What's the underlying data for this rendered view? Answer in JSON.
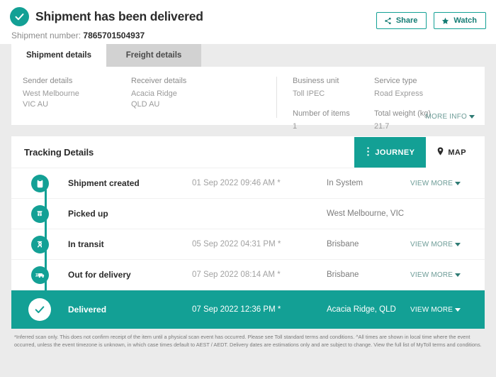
{
  "header": {
    "status_title": "Shipment has been delivered",
    "shipment_number_label": "Shipment number:",
    "shipment_number_value": "7865701504937",
    "share_label": "Share",
    "watch_label": "Watch"
  },
  "tabs": [
    {
      "label": "Shipment details",
      "active": true
    },
    {
      "label": "Freight details",
      "active": false
    }
  ],
  "details": {
    "sender": {
      "label": "Sender details",
      "line1": "West Melbourne",
      "line2": "VIC AU"
    },
    "receiver": {
      "label": "Receiver details",
      "line1": "Acacia Ridge",
      "line2": "QLD AU"
    },
    "business_unit": {
      "label": "Business unit",
      "value": "Toll IPEC"
    },
    "service_type": {
      "label": "Service type",
      "value": "Road Express"
    },
    "number_of_items": {
      "label": "Number of items",
      "value": "1"
    },
    "total_weight": {
      "label": "Total weight (kg)",
      "value": "21.7"
    },
    "more_info_label": "MORE INFO"
  },
  "tracking": {
    "title": "Tracking Details",
    "journey_label": "JOURNEY",
    "map_label": "MAP",
    "view_more_label": "VIEW MORE",
    "events": [
      {
        "icon": "clipboard-icon",
        "label": "Shipment created",
        "date": "01 Sep 2022 09:46 AM *",
        "location": "In System",
        "has_view_more": true,
        "delivered": false
      },
      {
        "icon": "pickup-box-icon",
        "label": "Picked up",
        "date": "",
        "location": "West Melbourne, VIC",
        "has_view_more": false,
        "delivered": false
      },
      {
        "icon": "in-transit-icon",
        "label": "In transit",
        "date": "05 Sep 2022 04:31 PM *",
        "location": "Brisbane",
        "has_view_more": true,
        "delivered": false
      },
      {
        "icon": "delivery-truck-icon",
        "label": "Out for delivery",
        "date": "07 Sep 2022 08:14 AM *",
        "location": "Brisbane",
        "has_view_more": true,
        "delivered": false
      },
      {
        "icon": "check-circle-icon",
        "label": "Delivered",
        "date": "07 Sep 2022 12:36 PM *",
        "location": "Acacia Ridge, QLD",
        "has_view_more": true,
        "delivered": true
      }
    ]
  },
  "footer": {
    "disclaimer": "*Inferred scan only. This does not confirm receipt of the item until a physical scan event has occurred. Please see Toll standard terms and conditions. ^All times are shown in local time where the event occurred, unless the event timezone is unknown, in which case times default to AEST / AEDT. Delivery dates are estimations only and are subject to change. View the full list of MyToll terms and conditions."
  },
  "colors": {
    "brand_teal": "#13a095",
    "page_bg": "#ebebeb",
    "card_bg": "#ffffff",
    "muted_text": "#9a9a9a",
    "link_teal": "#6d9c97"
  }
}
